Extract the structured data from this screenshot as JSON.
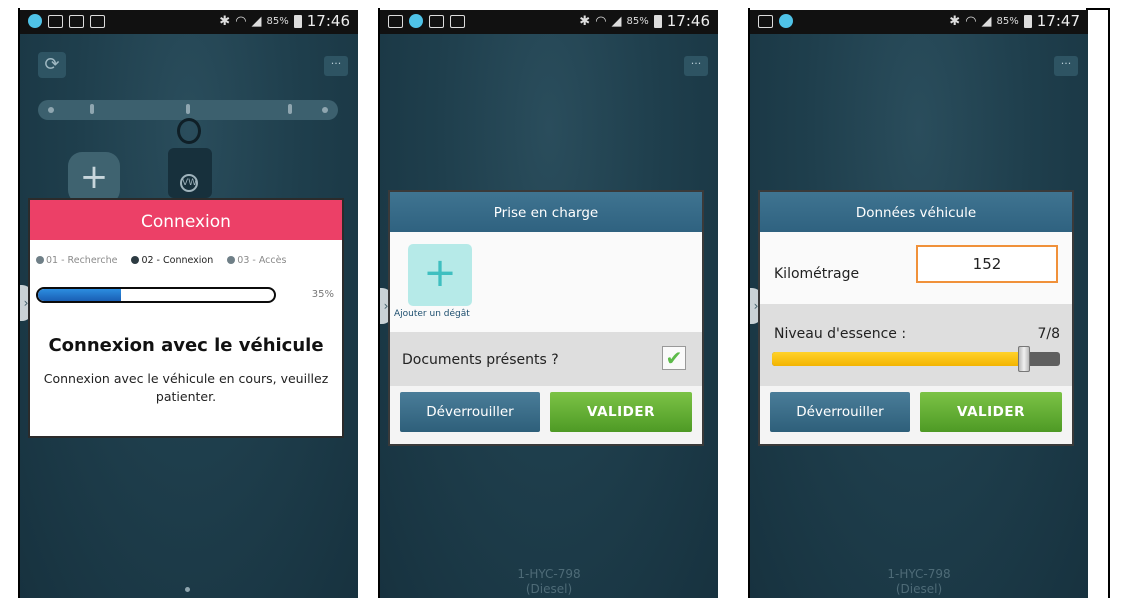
{
  "status_bars": [
    {
      "time": "17:46",
      "battery": "85%"
    },
    {
      "time": "17:46",
      "battery": "85%"
    },
    {
      "time": "17:47",
      "battery": "85%"
    }
  ],
  "icons": {
    "refresh": "refresh-icon",
    "menu": "more-icon",
    "add": "plus-icon",
    "checkbox": "check-icon",
    "side_tab": "chevron-right-icon"
  },
  "colors": {
    "connexion_header": "#ec4067",
    "dialog_header": "#3a6d8a",
    "valider": "#5fae32",
    "deverrouiller": "#3c6f8c",
    "fuel": "#ffc400",
    "km_border": "#f0913a"
  },
  "screen1": {
    "dialog_title": "Connexion",
    "steps": [
      {
        "label": "01 - Recherche",
        "active": false
      },
      {
        "label": "02 - Connexion",
        "active": true
      },
      {
        "label": "03 - Accès",
        "active": false
      }
    ],
    "progress_percent": 35,
    "progress_text": "35%",
    "heading": "Connexion avec le véhicule",
    "message": "Connexion avec le véhicule en cours, veuillez patienter."
  },
  "screen2": {
    "dialog_title": "Prise en charge",
    "add_damage_label": "Ajouter un dégât",
    "documents_label": "Documents présents ?",
    "documents_checked": true,
    "unlock_label": "Déverrouiller",
    "validate_label": "VALIDER",
    "plate": "1-HYC-798",
    "fuel_type": "(Diesel)"
  },
  "screen3": {
    "dialog_title": "Données véhicule",
    "km_label": "Kilométrage",
    "km_value": "152",
    "fuel_label": "Niveau d'essence :",
    "fuel_value": "7/8",
    "fuel_fraction": 0.875,
    "unlock_label": "Déverrouiller",
    "validate_label": "VALIDER",
    "plate": "1-HYC-798",
    "fuel_type": "(Diesel)"
  }
}
